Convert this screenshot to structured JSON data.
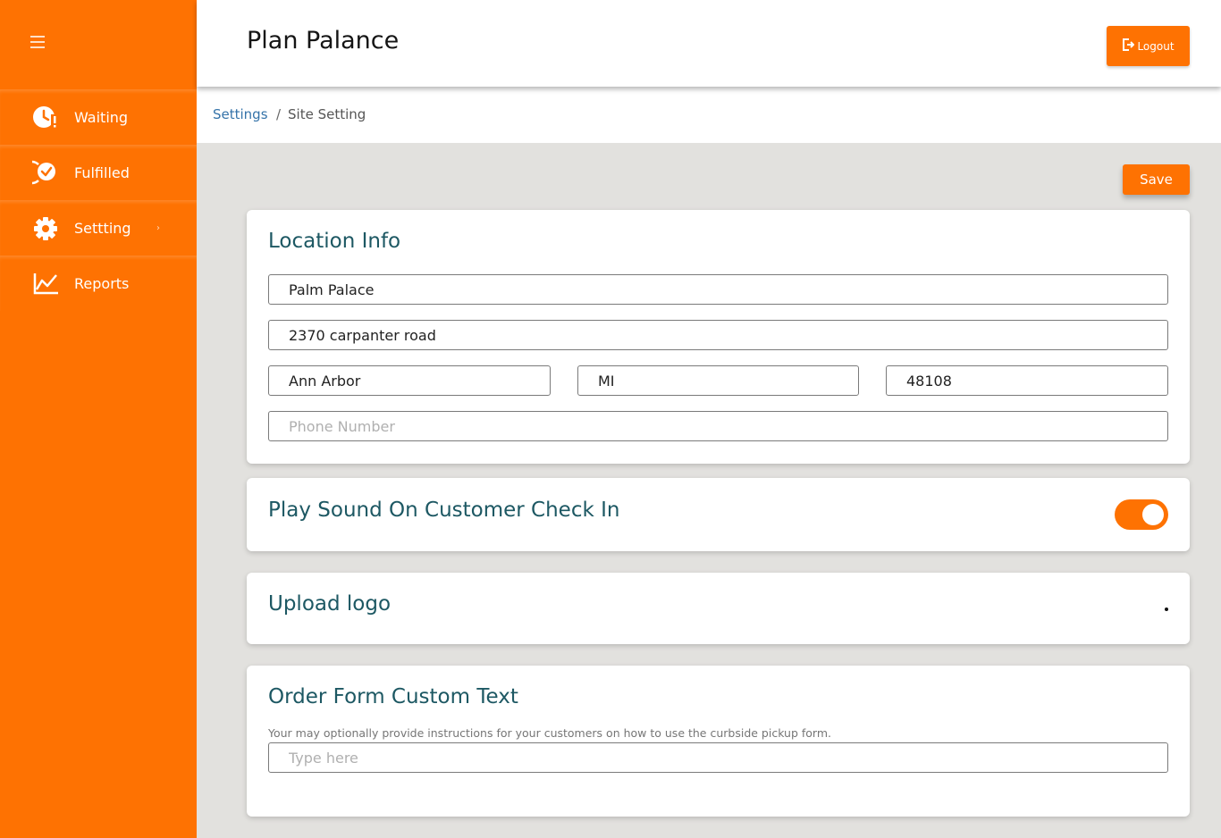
{
  "sidebar": {
    "items": [
      {
        "label": "Waiting",
        "icon": "clock-alert-icon"
      },
      {
        "label": "Fulfilled",
        "icon": "check-circle-icon"
      },
      {
        "label": "Settting",
        "icon": "gear-icon",
        "chevron": "›"
      },
      {
        "label": "Reports",
        "icon": "line-chart-icon"
      }
    ]
  },
  "header": {
    "title": "Plan Palance",
    "logout_label": "Logout"
  },
  "breadcrumb": {
    "parent": "Settings",
    "separator": "/",
    "current": "Site Setting"
  },
  "toolbar": {
    "save_label": "Save"
  },
  "location_info": {
    "title": "Location Info",
    "name": "Palm Palace",
    "address": "2370 carpanter road",
    "city": "Ann Arbor",
    "state": "MI",
    "zip": "48108",
    "phone_placeholder": "Phone Number"
  },
  "sound": {
    "title": "Play Sound On Customer Check In",
    "enabled": true
  },
  "logo": {
    "title": "Upload logo"
  },
  "custom_text": {
    "title": "Order Form Custom Text",
    "helper": "Your may optionally provide instructions for your customers on how to use the curbside pickup form.",
    "placeholder": "Type here"
  },
  "colors": {
    "accent": "#fe7202",
    "title_teal": "#1d5863",
    "link": "#3573a9",
    "background": "#e2e1de"
  }
}
